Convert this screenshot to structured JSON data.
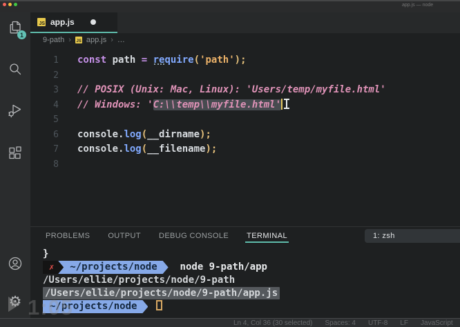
{
  "window": {
    "title": "app.js — node"
  },
  "activity_bar": {
    "explorer_badge": "1"
  },
  "icons": {
    "gear": "⚙",
    "js_badge": "JS",
    "breadcrumb_separator": "›",
    "prompt_error": "✗"
  },
  "tab": {
    "label": "app.js",
    "modified": true
  },
  "breadcrumb": {
    "items": [
      "9-path",
      "app.js",
      "…"
    ]
  },
  "editor": {
    "lines": [
      {
        "num": "1",
        "tokens": [
          {
            "c": "kw",
            "s": "const",
            "n": "keyword-const"
          },
          {
            "c": "pl",
            "s": " path "
          },
          {
            "c": "op",
            "s": "="
          },
          {
            "c": "pl",
            "s": " "
          },
          {
            "c": "fn dotted",
            "s": "require",
            "n": "require-call"
          },
          {
            "c": "par",
            "s": "("
          },
          {
            "c": "str",
            "s": "'path'",
            "n": "string-literal"
          },
          {
            "c": "par",
            "s": ")"
          },
          {
            "c": "par",
            "s": ";"
          }
        ]
      },
      {
        "num": "2",
        "tokens": []
      },
      {
        "num": "3",
        "tokens": [
          {
            "c": "cm",
            "s": "// POSIX (Unix: Mac, Linux): 'Users/temp/myfile.html'",
            "n": "comment"
          }
        ]
      },
      {
        "num": "4",
        "tokens": [
          {
            "c": "cm",
            "s": "// Windows: '",
            "n": "comment"
          },
          {
            "c": "cm sel",
            "s": "C:\\\\temp\\\\myfile.html'",
            "n": "selected-text"
          },
          {
            "c": "caret",
            "s": "",
            "n": "editor-caret"
          },
          {
            "c": "ibeam",
            "s": "",
            "n": "mouse-ibeam-cursor"
          }
        ]
      },
      {
        "num": "5",
        "tokens": []
      },
      {
        "num": "6",
        "tokens": [
          {
            "c": "pl",
            "s": "console."
          },
          {
            "c": "fn",
            "s": "log",
            "n": "log-call"
          },
          {
            "c": "par",
            "s": "("
          },
          {
            "c": "pl",
            "s": "__dirname",
            "n": "dirname-variable"
          },
          {
            "c": "par",
            "s": ")"
          },
          {
            "c": "par",
            "s": ";"
          }
        ]
      },
      {
        "num": "7",
        "tokens": [
          {
            "c": "pl",
            "s": "console."
          },
          {
            "c": "fn",
            "s": "log",
            "n": "log-call"
          },
          {
            "c": "par",
            "s": "("
          },
          {
            "c": "pl",
            "s": "__filename",
            "n": "filename-variable"
          },
          {
            "c": "par",
            "s": ")"
          },
          {
            "c": "par",
            "s": ";"
          }
        ]
      },
      {
        "num": "8",
        "tokens": []
      }
    ]
  },
  "panel": {
    "tabs": [
      "PROBLEMS",
      "OUTPUT",
      "DEBUG CONSOLE",
      "TERMINAL"
    ],
    "active_tab": "TERMINAL",
    "shell_selector": "1: zsh"
  },
  "terminal": {
    "lines": [
      {
        "segments": [
          {
            "c": "t-br",
            "s": "}"
          }
        ]
      },
      {
        "segments": [
          {
            "c": "seg seg-err",
            "s": "✗",
            "n": "prompt-error-indicator"
          },
          {
            "c": "seg seg-path",
            "s": "~/projects/node",
            "n": "prompt-cwd"
          },
          {
            "c": "t-cmd",
            "s": "  node 9-path/app",
            "n": "terminal-command"
          }
        ]
      },
      {
        "segments": [
          {
            "c": "t-out",
            "s": "/Users/ellie/projects/node/9-path",
            "n": "dirname-output"
          }
        ]
      },
      {
        "segments": [
          {
            "c": "t-out t-sel",
            "s": "/Users/ellie/projects/node/9-path/app.js",
            "n": "filename-output-selected"
          }
        ]
      },
      {
        "segments": [
          {
            "c": "seg seg-path",
            "s": "~/projects/node",
            "n": "prompt-cwd"
          },
          {
            "c": "cursor",
            "s": "",
            "n": "terminal-cursor"
          }
        ]
      }
    ]
  },
  "status_bar": {
    "right": [
      "Ln 4, Col 36 (30 selected)",
      "Spaces: 4",
      "UTF-8",
      "LF",
      "JavaScript"
    ]
  },
  "video_overlay": {
    "timestamp": "1:05"
  },
  "colors": {
    "accent_teal": "#5fbcab",
    "keyword_purple": "#c792ea",
    "function_blue": "#82aaff",
    "string_orange": "#ecb269",
    "paren_gold": "#e5c07b",
    "comment_pink": "#e093b8",
    "prompt_blue": "#86a9e8",
    "error_red": "#ef5350",
    "js_icon_yellow": "#e7c94c"
  }
}
